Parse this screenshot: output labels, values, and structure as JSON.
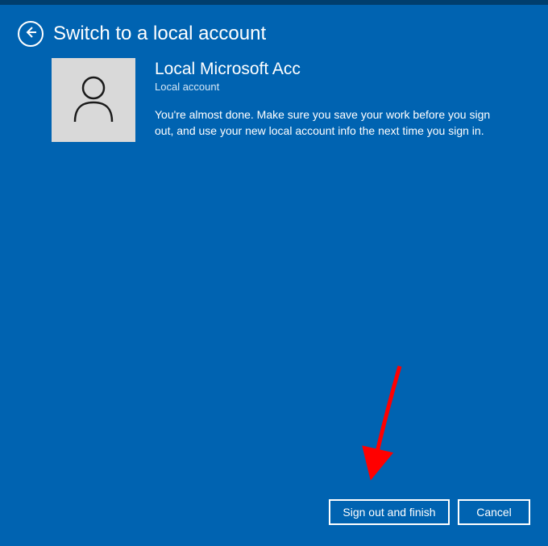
{
  "header": {
    "title": "Switch to a local account"
  },
  "account": {
    "name": "Local Microsoft Acc",
    "type": "Local account",
    "description": "You're almost done. Make sure you save your work before you sign out, and use your new local account info the next time you sign in."
  },
  "footer": {
    "primary_label": "Sign out and finish",
    "cancel_label": "Cancel"
  },
  "colors": {
    "bg": "#0063b1",
    "avatar_bg": "#d9d9d9",
    "arrow": "#ff0000"
  }
}
